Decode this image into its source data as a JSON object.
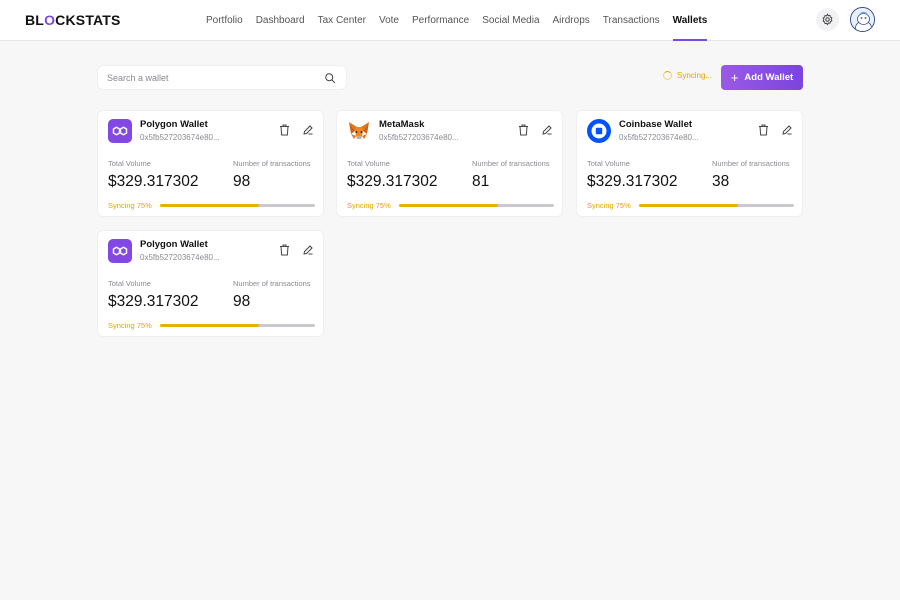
{
  "brand": {
    "before": "BL",
    "o": "O",
    "after": "CKSTATS"
  },
  "nav": [
    "Portfolio",
    "Dashboard",
    "Tax Center",
    "Vote",
    "Performance",
    "Social Media",
    "Airdrops",
    "Transactions",
    "Wallets"
  ],
  "nav_active": "Wallets",
  "search": {
    "placeholder": "Search a wallet",
    "value": ""
  },
  "sync_status": "Syncing...",
  "add_wallet_label": "Add Wallet",
  "colors": {
    "accent": "#7b4ae2",
    "syncing": "#e3a300",
    "polygon": "#8247e5",
    "coinbase": "#0052ff"
  },
  "wallets": [
    {
      "name": "Polygon Wallet",
      "icon": "polygon-icon",
      "address": "0x5fb527203674e80...",
      "volume_label": "Total Volume",
      "volume": "$329.317302",
      "tx_label": "Number of transactions",
      "tx": "98",
      "sync_label": "Syncing 75%",
      "progress": 0.64
    },
    {
      "name": "MetaMask",
      "icon": "metamask-icon",
      "address": "0x5fb527203674e80...",
      "volume_label": "Total Volume",
      "volume": "$329.317302",
      "tx_label": "Number of transactions",
      "tx": "81",
      "sync_label": "Syncing 75%",
      "progress": 0.64
    },
    {
      "name": "Coinbase Wallet",
      "icon": "coinbase-icon",
      "address": "0x5fb527203674e80...",
      "volume_label": "Total Volume",
      "volume": "$329.317302",
      "tx_label": "Number of transactions",
      "tx": "38",
      "sync_label": "Syncing 75%",
      "progress": 0.64
    },
    {
      "name": "Polygon Wallet",
      "icon": "polygon-icon",
      "address": "0x5fb527203674e80...",
      "volume_label": "Total Volume",
      "volume": "$329.317302",
      "tx_label": "Number of transactions",
      "tx": "98",
      "sync_label": "Syncing 75%",
      "progress": 0.64
    }
  ]
}
